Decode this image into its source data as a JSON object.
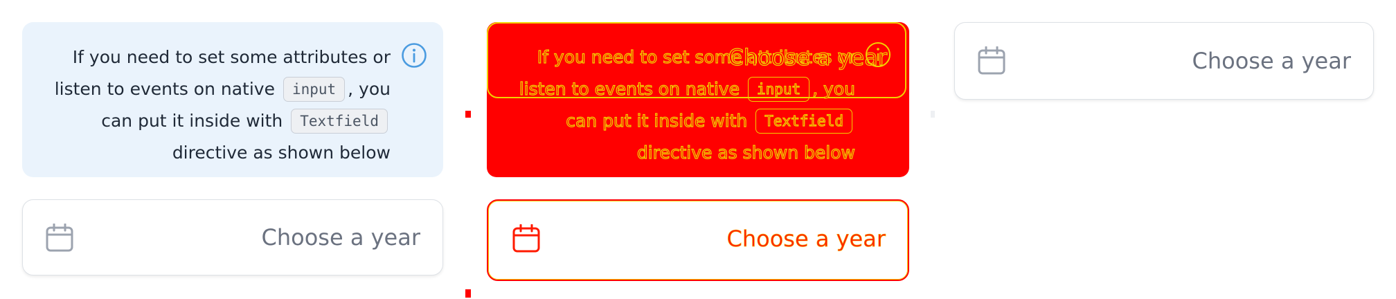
{
  "note": {
    "text_before_input": "If you need to set some attributes or listen to events on native",
    "code_input": "input",
    "text_between": ", you can put it inside with",
    "code_textfield": "Textfield",
    "text_after": "directive as shown below",
    "icon": "info-icon"
  },
  "textfield": {
    "placeholder": "Choose a year",
    "icon": "calendar-icon"
  },
  "colors": {
    "note_background": "#eaf3fc",
    "info_icon": "#4a9be0",
    "diff_fill": "#ff0000",
    "diff_outline": "#f2d200",
    "placeholder_text": "#6b7280",
    "calendar_icon": "#9ca3af"
  }
}
